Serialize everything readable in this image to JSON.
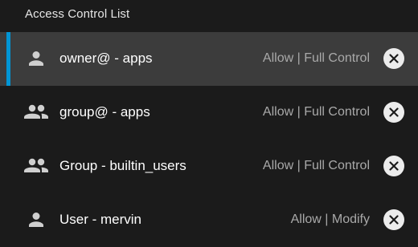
{
  "panel": {
    "title": "Access Control List"
  },
  "colors": {
    "background": "#1b1b1b",
    "selected_row": "#3c3c3c",
    "selection_accent": "#0095d5",
    "permission_text": "#a9a9a9",
    "remove_button": "#ececec"
  },
  "entries": [
    {
      "icon": "person-icon",
      "name": "owner@ - apps",
      "permission": "Allow | Full Control",
      "selected": true
    },
    {
      "icon": "group-icon",
      "name": "group@ - apps",
      "permission": "Allow | Full Control",
      "selected": false
    },
    {
      "icon": "group-icon",
      "name": "Group - builtin_users",
      "permission": "Allow | Full Control",
      "selected": false
    },
    {
      "icon": "person-icon",
      "name": "User - mervin",
      "permission": "Allow | Modify",
      "selected": false
    }
  ]
}
